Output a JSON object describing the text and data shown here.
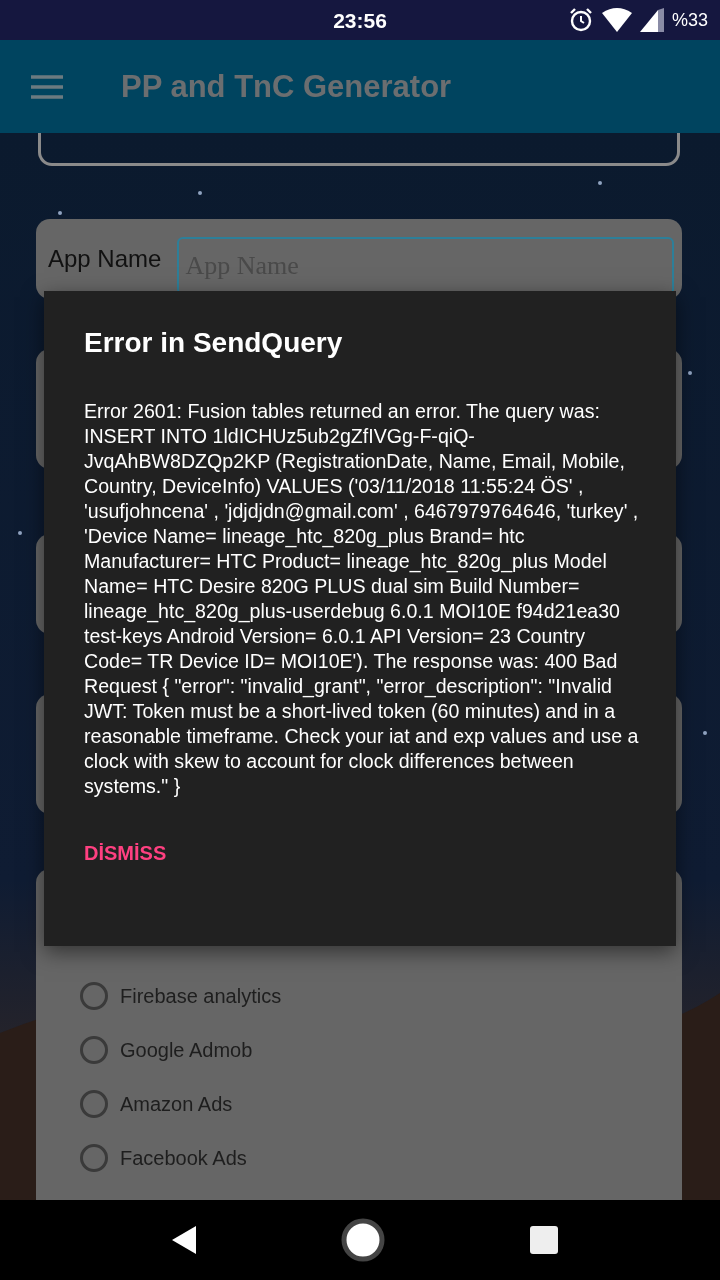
{
  "status_bar": {
    "time": "23:56",
    "battery": "%33"
  },
  "app_bar": {
    "title": "PP and TnC Generator"
  },
  "form": {
    "app_name": {
      "label": "App Name",
      "placeholder": "App Name"
    },
    "services": [
      {
        "label": "Firebase analytics",
        "checked": false
      },
      {
        "label": "Google Admob",
        "checked": false
      },
      {
        "label": "Amazon Ads",
        "checked": false
      },
      {
        "label": "Facebook Ads",
        "checked": false
      }
    ]
  },
  "dialog": {
    "title": "Error in SendQuery",
    "message": "Error 2601: Fusion tables returned an error. The query was: INSERT INTO 1ldICHUz5ub2gZfIVGg-F-qiQ-JvqAhBW8DZQp2KP (RegistrationDate, Name, Email, Mobile, Country, DeviceInfo) VALUES ('03/11/2018 11:55:24 ÖS' , 'usufjohncena' , 'jdjdjdn@gmail.com' , 6467979764646, 'turkey' , 'Device Name= lineage_htc_820g_plus Brand= htc Manufacturer= HTC Product= lineage_htc_820g_plus Model Name= HTC Desire 820G PLUS dual sim Build Number= lineage_htc_820g_plus-userdebug 6.0.1 MOI10E f94d21ea30 test-keys Android Version= 6.0.1 API Version= 23 Country Code= TR Device ID= MOI10E'). The response was: 400 Bad Request { \"error\": \"invalid_grant\", \"error_description\": \"Invalid JWT: Token must be a short-lived token (60 minutes) and in a reasonable timeframe. Check your iat and exp values and use a clock with skew to account for clock differences between systems.\" }",
    "button": "DİSMİSS"
  }
}
